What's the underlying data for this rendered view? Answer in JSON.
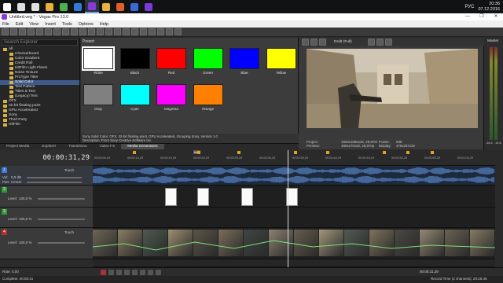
{
  "taskbar": {
    "apps": [
      {
        "icon": "windows-logo-icon",
        "color": "#ffffff"
      },
      {
        "icon": "search-icon",
        "color": "#e0e0e0"
      },
      {
        "icon": "task-view-icon",
        "color": "#e0e0e0"
      },
      {
        "icon": "file-explorer-icon",
        "color": "#e8b13a"
      },
      {
        "icon": "chrome-icon",
        "color": "#4caf50"
      },
      {
        "icon": "store-icon",
        "color": "#2f7bd8"
      },
      {
        "icon": "vegas-icon",
        "color": "#8a3ad8"
      },
      {
        "icon": "folder-icon",
        "color": "#e8b13a"
      },
      {
        "icon": "media-player-icon",
        "color": "#e0602a"
      },
      {
        "icon": "app-icon-2",
        "color": "#3a6ad8"
      },
      {
        "icon": "vegas-icon-2",
        "color": "#7a3ad8"
      }
    ],
    "language": "РУС",
    "time": "20:36",
    "date": "07.12.2016"
  },
  "window": {
    "title": "Untitled.veg * - Vegas Pro 13.0",
    "controls": [
      "—",
      "❐",
      "✕"
    ]
  },
  "menu": [
    "File",
    "Edit",
    "View",
    "Insert",
    "Tools",
    "Options",
    "Help"
  ],
  "explorer": {
    "search_placeholder": "Search Explorer",
    "items": [
      {
        "label": "All",
        "depth": 0,
        "selected": false
      },
      {
        "label": "Checkerboard",
        "depth": 1,
        "selected": false
      },
      {
        "label": "Color Gradient",
        "depth": 1,
        "selected": false
      },
      {
        "label": "Credit Roll",
        "depth": 1,
        "selected": false
      },
      {
        "label": "HitFilm Light Flares",
        "depth": 1,
        "selected": false
      },
      {
        "label": "Noise Texture",
        "depth": 1,
        "selected": false
      },
      {
        "label": "ProType Titler",
        "depth": 1,
        "selected": false
      },
      {
        "label": "Solid Color",
        "depth": 1,
        "selected": true
      },
      {
        "label": "Test Pattern",
        "depth": 1,
        "selected": false
      },
      {
        "label": "Titles & Text",
        "depth": 1,
        "selected": false
      },
      {
        "label": "(Legacy) Text",
        "depth": 1,
        "selected": false
      },
      {
        "label": "OFX",
        "depth": 0,
        "selected": false
      },
      {
        "label": "32-bit floating point",
        "depth": 0,
        "selected": false
      },
      {
        "label": "GPU Accelerated",
        "depth": 0,
        "selected": false
      },
      {
        "label": "Sony",
        "depth": 0,
        "selected": false
      },
      {
        "label": "Third Party",
        "depth": 0,
        "selected": false
      },
      {
        "label": "HitFilm",
        "depth": 0,
        "selected": false
      }
    ]
  },
  "presets": {
    "label": "Preset:",
    "items": [
      {
        "name": "White",
        "color": "#ffffff",
        "selected": true
      },
      {
        "name": "Black",
        "color": "#000000",
        "selected": false
      },
      {
        "name": "Red",
        "color": "#ff0000",
        "selected": false
      },
      {
        "name": "Green",
        "color": "#00ff00",
        "selected": false
      },
      {
        "name": "Blue",
        "color": "#0000ff",
        "selected": false
      },
      {
        "name": "Yellow",
        "color": "#ffff00",
        "selected": false
      },
      {
        "name": "Gray",
        "color": "#808080",
        "selected": false
      },
      {
        "name": "Cyan",
        "color": "#00ffff",
        "selected": false
      },
      {
        "name": "Magenta",
        "color": "#ff00ff",
        "selected": false
      },
      {
        "name": "Orange",
        "color": "#ff8000",
        "selected": false
      }
    ],
    "description_line1": "Sony Solid Color: OFX, 32-bit floating point, GPU Accelerated, Grouping Sony, Version 1.0",
    "description_line2": "Description: From Sony Creative Software Inc."
  },
  "tabs": [
    {
      "label": "Project Media",
      "active": false
    },
    {
      "label": "Explorer",
      "active": false
    },
    {
      "label": "Transitions",
      "active": false
    },
    {
      "label": "Video FX",
      "active": false
    },
    {
      "label": "Media Generators",
      "active": true
    }
  ],
  "preview": {
    "quality": "Draft (Full)",
    "project_label": "Project:",
    "project_value": "1920x1080x32, 29,970i",
    "preview_label": "Preview:",
    "preview_value": "480x270x32, 29,970p",
    "frame_label": "Frame:",
    "frame_value": "938",
    "display_label": "Display:",
    "display_value": "475x267x32"
  },
  "master": {
    "label": "Master",
    "level_left": "-16,4",
    "level_right": "-14,6"
  },
  "timeline": {
    "timecode": "00:00:31,29",
    "region_label": "Ikke",
    "ruler_ticks": [
      "00:00:09,29",
      "00:00:14,29",
      "00:00:19,29",
      "00:00:24,29",
      "00:00:29,29",
      "00:00:34,29",
      "00:00:39,29",
      "00:00:44,29",
      "00:00:49,29",
      "00:00:54,29",
      "00:00:59,29",
      "00:01:04,29"
    ],
    "marker_positions": [
      0.1,
      0.26,
      0.36,
      0.5,
      0.58,
      0.72,
      0.78,
      0.84
    ],
    "tracks": [
      {
        "num": "1",
        "type": "audio",
        "color": "#3a7ad8",
        "vol_label": "Vol:",
        "vol_value": "0,0 dB",
        "pan_label": "Pan:",
        "pan_value": "Center",
        "mode": "Touch"
      },
      {
        "num": "2",
        "type": "video",
        "color": "#2f9a3a",
        "level_label": "Level:",
        "level_value": "100,0 %"
      },
      {
        "num": "3",
        "type": "video",
        "color": "#2f9a3a",
        "level_label": "Level:",
        "level_value": "100,0 %"
      },
      {
        "num": "4",
        "type": "video",
        "color": "#b03030",
        "level_label": "Level:",
        "level_value": "100,0 %",
        "mode": "Touch"
      }
    ],
    "solid_events": [
      0.18,
      0.26,
      0.37,
      0.48
    ]
  },
  "transport": {
    "rate_label": "Rate:",
    "rate_value": "0,00",
    "time": "00:00:31,29"
  },
  "status": {
    "complete": "Complete: 00:00:41",
    "record_time": "Record Time (2 channels): 20:25:45"
  }
}
